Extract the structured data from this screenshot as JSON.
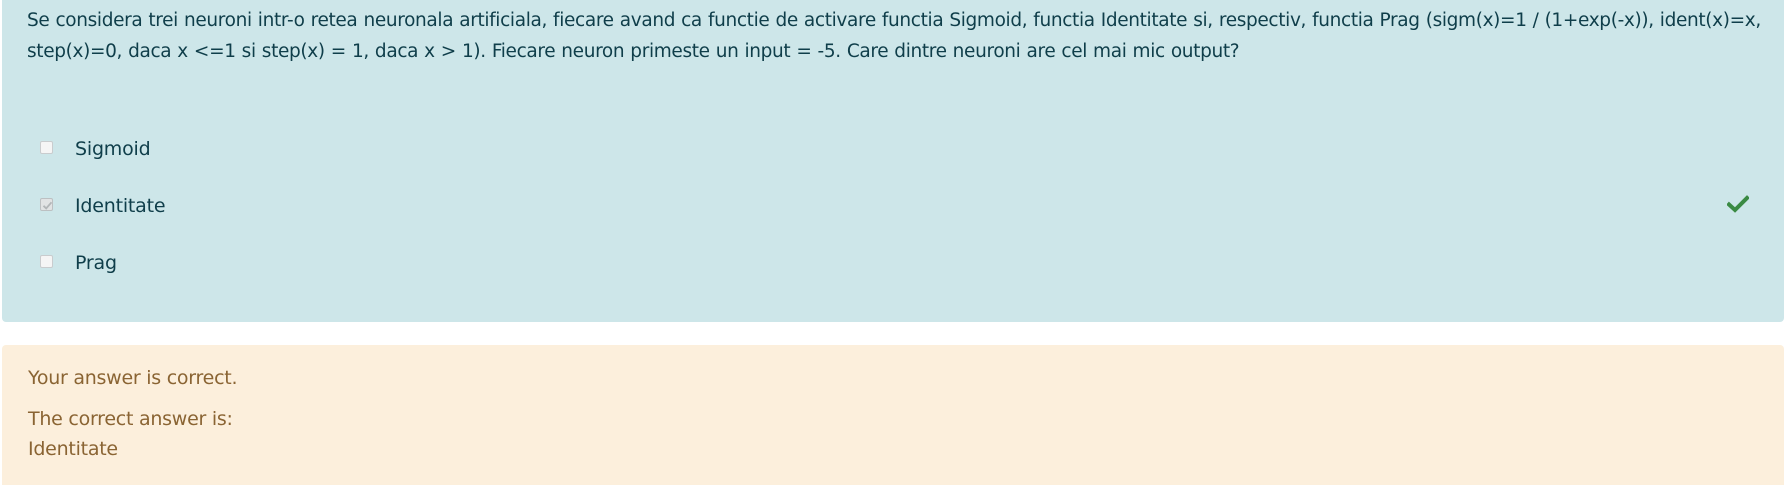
{
  "question": {
    "text": "Se considera trei neuroni intr-o retea neuronala artificiala, fiecare avand ca functie de activare functia Sigmoid, functia Identitate si, respectiv, functia Prag (sigm(x)=1 / (1+exp(-x)), ident(x)=x, step(x)=0, daca x <=1 si step(x) = 1, daca x > 1). Fiecare neuron primeste un input = -5. Care dintre neuroni are cel mai mic output?",
    "answers": [
      {
        "label": "Sigmoid",
        "checked": false
      },
      {
        "label": "Identitate",
        "checked": true
      },
      {
        "label": "Prag",
        "checked": false
      }
    ]
  },
  "feedback": {
    "result": "Your answer is correct.",
    "correct_intro": "The correct answer is:",
    "correct_value": "Identitate"
  },
  "icons": {
    "correct_mark": "check-icon"
  },
  "colors": {
    "question_bg": "#cde6e9",
    "question_text": "#0f3e4a",
    "feedback_bg": "#fcefdc",
    "feedback_text": "#8a6433",
    "check_green": "#3a8a43"
  }
}
